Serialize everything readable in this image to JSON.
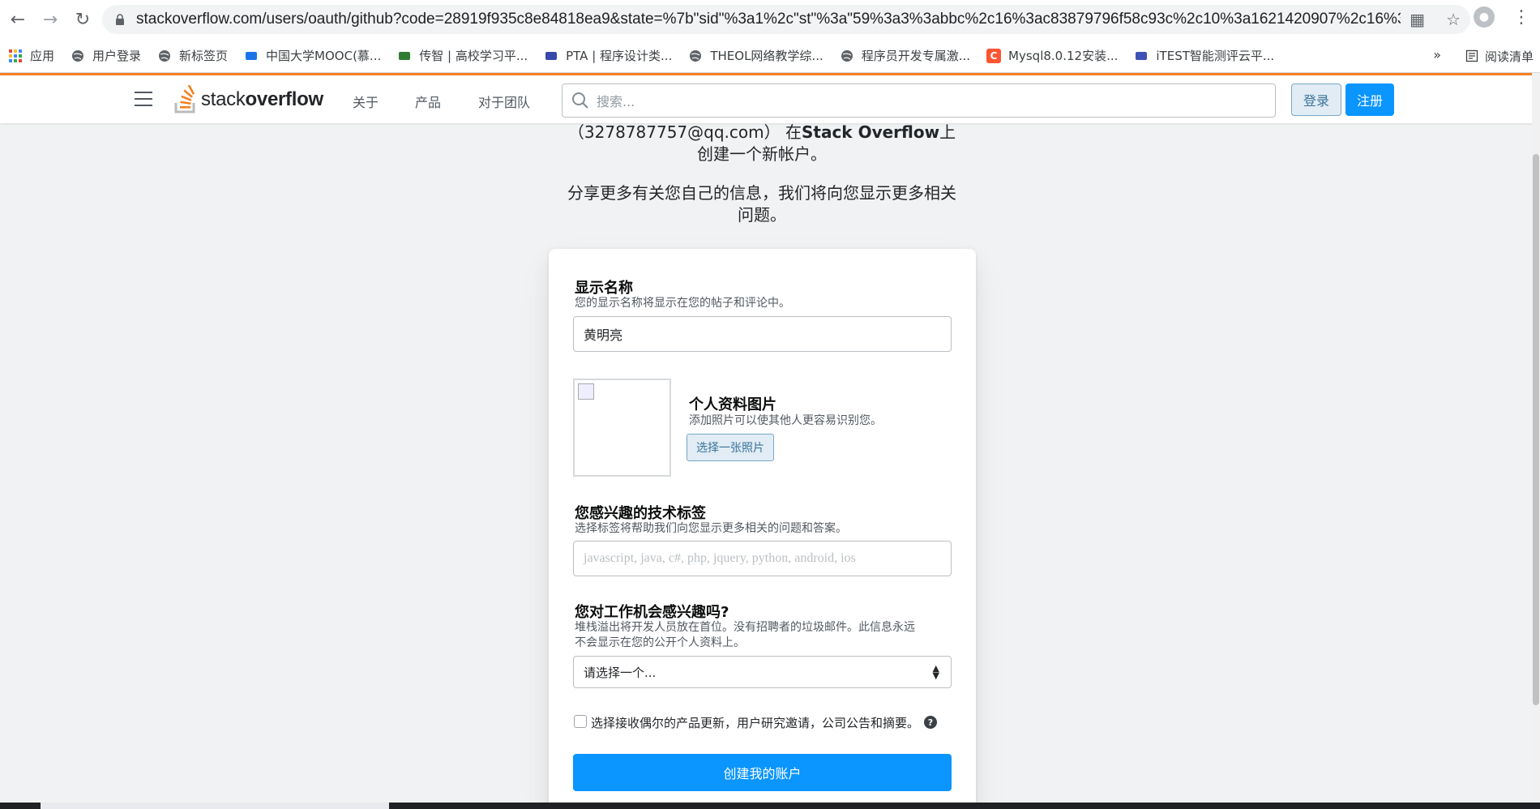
{
  "browser": {
    "url": "stackoverflow.com/users/oauth/github?code=28919f935c8e84818ea9&state=%7b\"sid\"%3a1%2c\"st\"%3a\"59%3a3%3abbc%2c16%3ac83879796f58c93c%2c10%3a1621420907%2c16%3...",
    "bookmarks": [
      {
        "label": "应用",
        "icon": "apps-grid-icon",
        "color": "#e8453c"
      },
      {
        "label": "用户登录",
        "icon": "globe-icon",
        "color": "#5f6368"
      },
      {
        "label": "新标签页",
        "icon": "globe-icon",
        "color": "#5f6368"
      },
      {
        "label": "中国大学MOOC(慕...",
        "icon": "mooc-icon",
        "color": "#1a73e8"
      },
      {
        "label": "传智 | 高校学习平...",
        "icon": "graduation-cap-icon",
        "color": "#2e7d32"
      },
      {
        "label": "PTA | 程序设计类...",
        "icon": "pta-icon",
        "color": "#3949ab"
      },
      {
        "label": "THEOL网络教学综...",
        "icon": "globe-icon",
        "color": "#5f6368"
      },
      {
        "label": "程序员开发专属激...",
        "icon": "globe-icon",
        "color": "#5f6368"
      },
      {
        "label": "Mysql8.0.12安装...",
        "icon": "csdn-icon",
        "color": "#fc5531"
      },
      {
        "label": "iTEST智能测评云平...",
        "icon": "itest-icon",
        "color": "#3f51b5"
      }
    ],
    "more": "»",
    "reading_list": "阅读清单"
  },
  "topbar": {
    "logo_light": "stack",
    "logo_bold": "overflow",
    "nav": [
      "关于",
      "产品",
      "对于团队"
    ],
    "search_placeholder": "搜索...",
    "login": "登录",
    "signup": "注册",
    "accent": "#f48024",
    "primary": "#0a95ff"
  },
  "intro": {
    "line1_prefix": "（3278787757@qq.com） 在",
    "line1_bold": "Stack Overflow",
    "line1_suffix": "上创建一个新帐户。",
    "line2": "分享更多有关您自己的信息，我们将向您显示更多相关问题。"
  },
  "form": {
    "display_name": {
      "title": "显示名称",
      "desc": "您的显示名称将显示在您的帖子和评论中。",
      "value": "黄明亮"
    },
    "photo": {
      "title": "个人资料图片",
      "desc": "添加照片可以使其他人更容易识别您。",
      "button": "选择一张照片"
    },
    "tags": {
      "title": "您感兴趣的技术标签",
      "desc": "选择标签将帮助我们向您显示更多相关的问题和答案。",
      "placeholder": "javascript, java, c#, php, jquery, python, android, ios"
    },
    "jobs": {
      "title": "您对工作机会感兴趣吗?",
      "desc_line1": "堆栈溢出将开发人员放在首位。没有招聘者的垃圾邮件。此信息永远",
      "desc_line2": "不会显示在您的公开个人资料上。",
      "selected": "请选择一个..."
    },
    "opt_in": "选择接收偶尔的产品更新，用户研究邀请，公司公告和摘要。",
    "submit": "创建我的账户"
  }
}
